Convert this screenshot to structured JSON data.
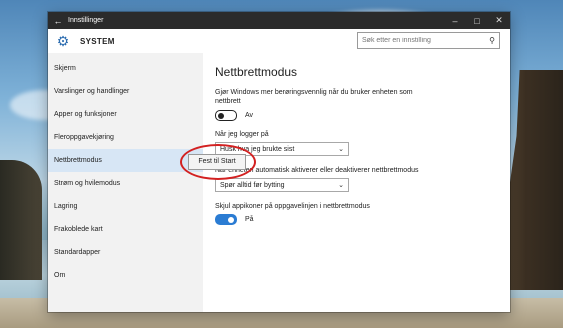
{
  "window": {
    "title": "Innstillinger"
  },
  "header": {
    "section": "SYSTEM",
    "search_placeholder": "Søk etter en innstilling"
  },
  "sidebar": {
    "items": [
      {
        "label": "Skjerm",
        "active": false
      },
      {
        "label": "Varslinger og handlinger",
        "active": false
      },
      {
        "label": "Apper og funksjoner",
        "active": false
      },
      {
        "label": "Fleroppgavekjøring",
        "active": false
      },
      {
        "label": "Nettbrettmodus",
        "active": true
      },
      {
        "label": "Strøm og hvilemodus",
        "active": false
      },
      {
        "label": "Lagring",
        "active": false
      },
      {
        "label": "Frakoblede kart",
        "active": false
      },
      {
        "label": "Standardapper",
        "active": false
      },
      {
        "label": "Om",
        "active": false
      }
    ]
  },
  "main": {
    "title": "Nettbrettmodus",
    "touch_desc": "Gjør Windows mer berøringsvennlig når du bruker enheten som nettbrett",
    "touch_toggle": {
      "state": "Av",
      "on": false
    },
    "signin_label": "Når jeg logger på",
    "signin_value": "Husk hva jeg brukte sist",
    "switch_label": "Når enheten automatisk aktiverer eller deaktiverer nettbrettmodus",
    "switch_value": "Spør alltid før bytting",
    "hide_label": "Skjul appikoner på oppgavelinjen i nettbrettmodus",
    "hide_toggle": {
      "state": "På",
      "on": true
    }
  },
  "tooltip": {
    "text": "Fest til Start"
  },
  "colors": {
    "accent": "#2b7cd3",
    "titlebar": "#2b2b2b",
    "annotation": "#d32121",
    "active_item": "#d7e6f5"
  },
  "icons": {
    "back": "back-arrow-icon",
    "settings": "gear-icon",
    "search": "search-icon"
  }
}
